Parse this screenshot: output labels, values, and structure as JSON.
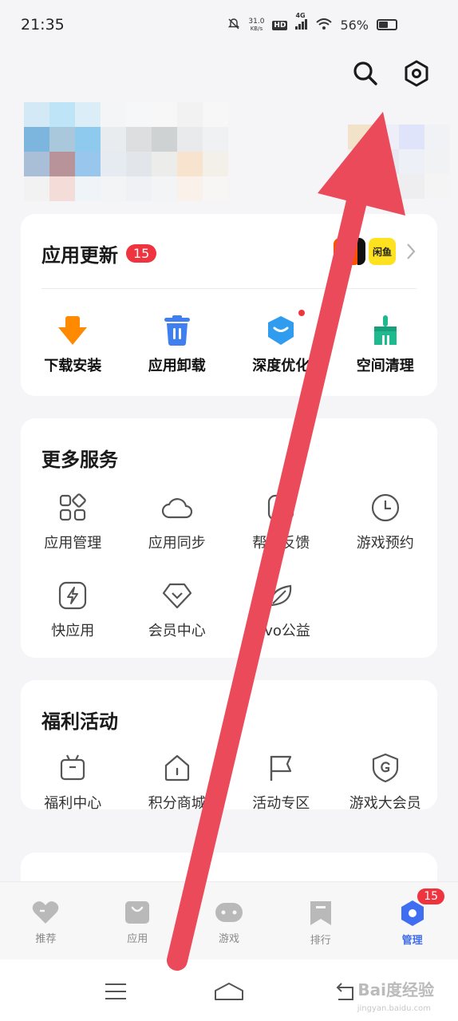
{
  "status_bar": {
    "time": "21:35",
    "net_speed_value": "31.0",
    "net_speed_unit": "KB/s",
    "hd_label": "HD",
    "signal_label": "4G",
    "battery_percent": "56%"
  },
  "updates_card": {
    "title": "应用更新",
    "badge": "15",
    "app_thumbs": [
      {
        "label": "淘",
        "color": "#ff5000"
      },
      {
        "label": "",
        "color": "#111111"
      },
      {
        "label": "闲鱼",
        "color": "#ffe21f"
      }
    ],
    "actions": [
      {
        "label": "下载安装",
        "icon": "download-arrow-icon",
        "color": "#ff8a00"
      },
      {
        "label": "应用卸载",
        "icon": "trash-icon",
        "color": "#3f7ff0"
      },
      {
        "label": "深度优化",
        "icon": "optimize-icon",
        "color": "#2f9cf0"
      },
      {
        "label": "空间清理",
        "icon": "broom-icon",
        "color": "#1fb98f"
      }
    ]
  },
  "more_services": {
    "title": "更多服务",
    "items": [
      {
        "label": "应用管理",
        "icon": "apps-grid-icon"
      },
      {
        "label": "应用同步",
        "icon": "cloud-icon"
      },
      {
        "label": "帮助反馈",
        "icon": "help-icon"
      },
      {
        "label": "游戏预约",
        "icon": "clock-icon"
      },
      {
        "label": "快应用",
        "icon": "bolt-icon"
      },
      {
        "label": "会员中心",
        "icon": "diamond-icon"
      },
      {
        "label": "vivo公益",
        "icon": "leaf-icon"
      }
    ]
  },
  "welfare": {
    "title": "福利活动",
    "items": [
      {
        "label": "福利中心",
        "icon": "gift-icon"
      },
      {
        "label": "积分商城",
        "icon": "house-icon"
      },
      {
        "label": "活动专区",
        "icon": "flag-icon"
      },
      {
        "label": "游戏大会员",
        "icon": "shield-g-icon"
      }
    ]
  },
  "bottom_nav": {
    "items": [
      {
        "label": "推荐",
        "icon": "heart-icon",
        "active": false
      },
      {
        "label": "应用",
        "icon": "bag-icon",
        "active": false
      },
      {
        "label": "游戏",
        "icon": "gamepad-icon",
        "active": false
      },
      {
        "label": "排行",
        "icon": "bookmark-icon",
        "active": false
      },
      {
        "label": "管理",
        "icon": "hexagon-icon",
        "active": true
      }
    ],
    "manage_badge": "15"
  },
  "watermark": {
    "text": "Bai度经验",
    "sub": "jingyan.baidu.com"
  },
  "colors": {
    "accent": "#3f6ef2",
    "badge": "#f0343f",
    "arrow": "#ea4a5a"
  }
}
